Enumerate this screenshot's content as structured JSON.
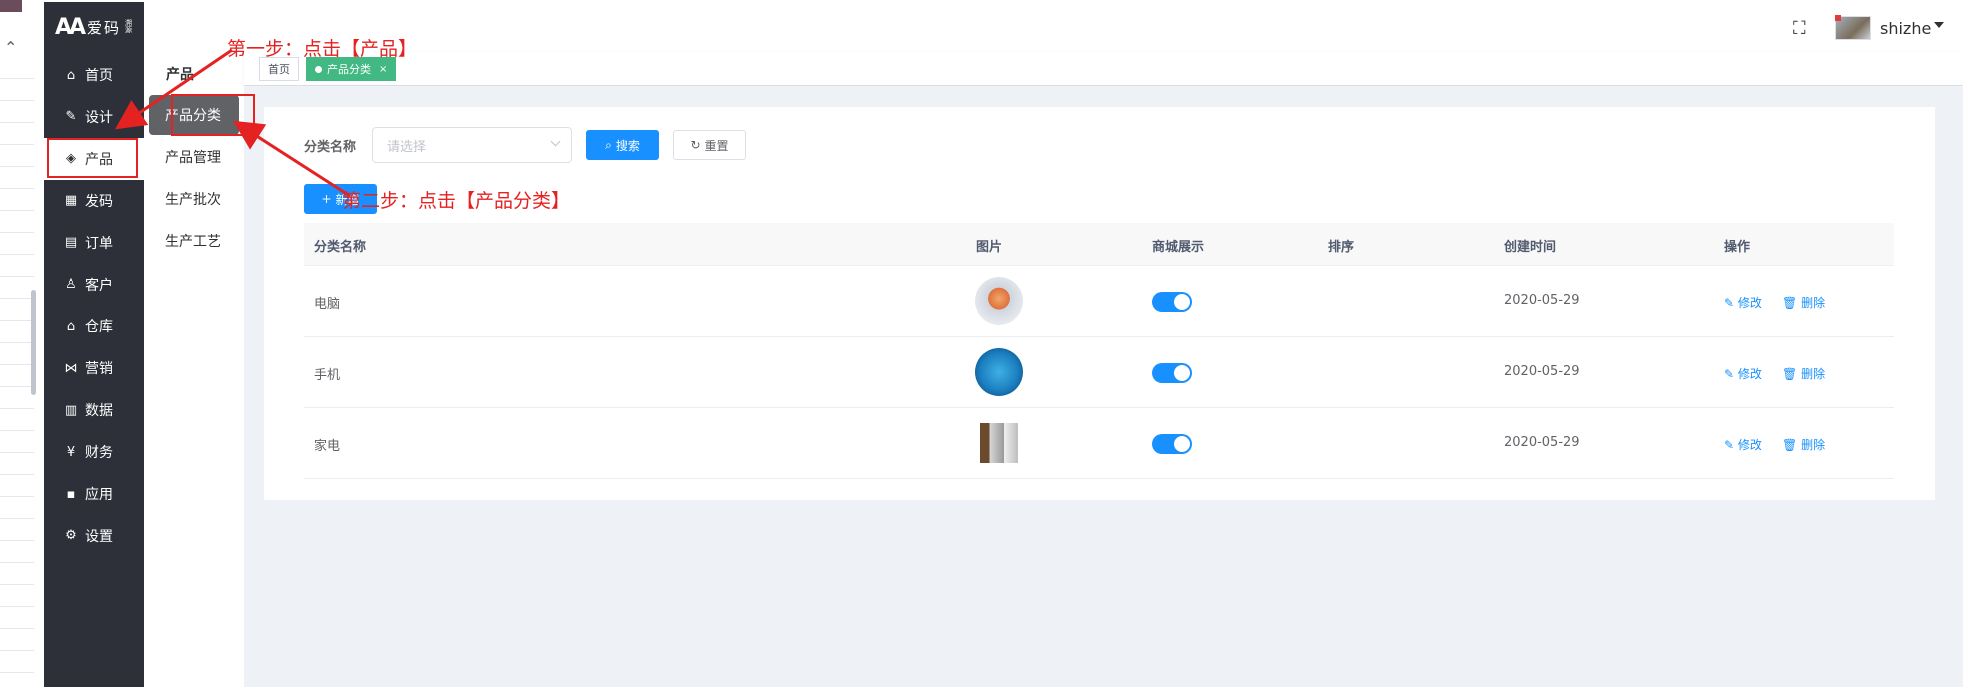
{
  "app": {
    "logo_text": "爱码",
    "logo_sub": "溯源"
  },
  "sidebar": {
    "items": [
      {
        "label": "首页",
        "icon": "home-icon",
        "glyph": "⌂"
      },
      {
        "label": "设计",
        "icon": "design-icon",
        "glyph": "✎"
      },
      {
        "label": "产品",
        "icon": "cube-icon",
        "glyph": "◈"
      },
      {
        "label": "发码",
        "icon": "qrcode-icon",
        "glyph": "▦"
      },
      {
        "label": "订单",
        "icon": "order-icon",
        "glyph": "▤"
      },
      {
        "label": "客户",
        "icon": "customer-icon",
        "glyph": "♙"
      },
      {
        "label": "仓库",
        "icon": "warehouse-icon",
        "glyph": "⌂"
      },
      {
        "label": "营销",
        "icon": "share-icon",
        "glyph": "⋈"
      },
      {
        "label": "数据",
        "icon": "chart-icon",
        "glyph": "▥"
      },
      {
        "label": "财务",
        "icon": "yuan-icon",
        "glyph": "¥"
      },
      {
        "label": "应用",
        "icon": "apps-icon",
        "glyph": "▪"
      },
      {
        "label": "设置",
        "icon": "gear-icon",
        "glyph": "⚙"
      }
    ],
    "active_index": 2
  },
  "subbar": {
    "title": "产品",
    "items": [
      {
        "label": "产品分类"
      },
      {
        "label": "产品管理"
      },
      {
        "label": "生产批次"
      },
      {
        "label": "生产工艺"
      }
    ],
    "active_index": 0
  },
  "header": {
    "username": "shizhe"
  },
  "tabs": [
    {
      "label": "首页"
    },
    {
      "label": "产品分类",
      "close": "×"
    }
  ],
  "filter": {
    "label": "分类名称",
    "placeholder": "请选择",
    "search_label": "搜索",
    "reset_label": "重置",
    "add_label": "新增"
  },
  "table": {
    "columns": [
      "分类名称",
      "图片",
      "商城展示",
      "排序",
      "创建时间",
      "操作"
    ],
    "rows": [
      {
        "name": "电脑",
        "image": "computer-thumbnail",
        "mall_display": true,
        "sort": "",
        "created": "2020-05-29"
      },
      {
        "name": "手机",
        "image": "phone-thumbnail",
        "mall_display": true,
        "sort": "",
        "created": "2020-05-29"
      },
      {
        "name": "家电",
        "image": "appliance-thumbnail",
        "mall_display": true,
        "sort": "",
        "created": "2020-05-29"
      }
    ],
    "edit_label": "修改",
    "delete_label": "删除"
  },
  "annotations": {
    "step1": "第一步：点击【产品】",
    "step2": "第二步：点击【产品分类】"
  },
  "colors": {
    "primary": "#1890ff",
    "sidebar_bg": "#2d3039",
    "tag_active": "#42b983",
    "annotation": "#e52222"
  }
}
